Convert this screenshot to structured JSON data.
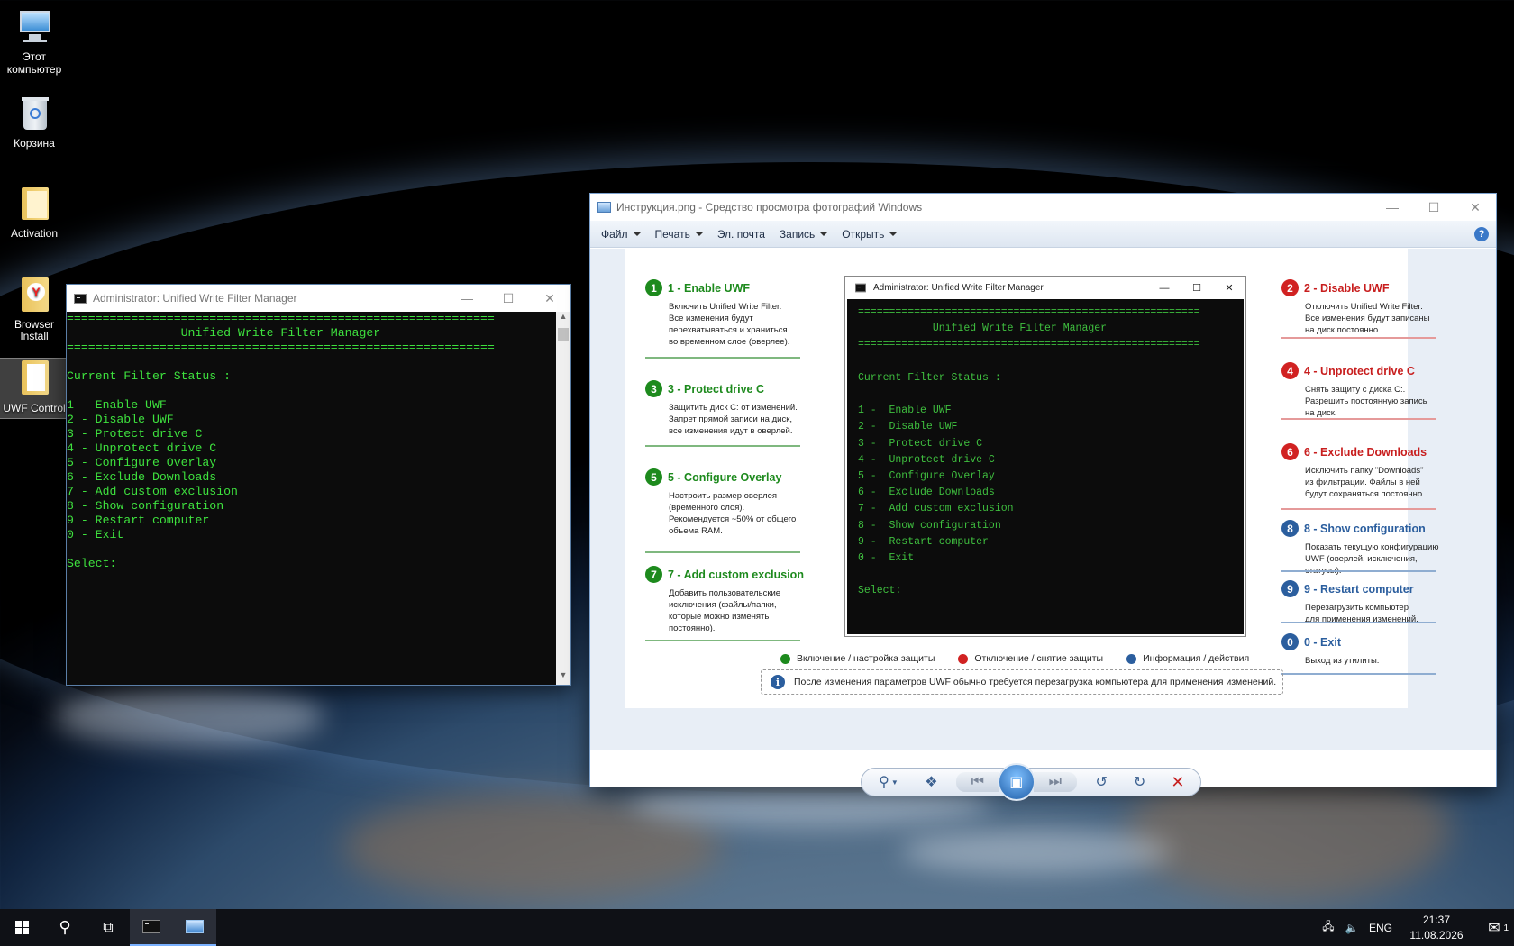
{
  "desktop": {
    "icons": [
      {
        "label": "Этот компьютер",
        "icon": "computer-icon"
      },
      {
        "label": "Корзина",
        "icon": "recycle-bin-icon"
      },
      {
        "label": "Activation",
        "icon": "folder-icon"
      },
      {
        "label": "Browser Install",
        "icon": "yandex-browser-icon"
      },
      {
        "label": "UWF Control",
        "icon": "folder-icon"
      }
    ]
  },
  "cmd_window": {
    "title": "Administrator:  Unified Write Filter Manager",
    "lines": [
      "============================================================",
      "                Unified Write Filter Manager",
      "============================================================",
      "",
      "Current Filter Status :",
      "",
      "1 - Enable UWF",
      "2 - Disable UWF",
      "3 - Protect drive C",
      "4 - Unprotect drive C",
      "5 - Configure Overlay",
      "6 - Exclude Downloads",
      "7 - Add custom exclusion",
      "8 - Show configuration",
      "9 - Restart computer",
      "0 - Exit",
      "",
      "Select:"
    ]
  },
  "viewer_window": {
    "title": "Инструкция.png - Средство просмотра фотографий Windows",
    "menu": [
      "Файл",
      "Печать",
      "Эл. почта",
      "Запись",
      "Открыть"
    ],
    "menu_has_arrow": [
      true,
      true,
      false,
      true,
      true
    ],
    "help": "?",
    "image": {
      "inner_cmd_title": "Administrator:  Unified Write Filter Manager",
      "inner_cmd_lines": [
        "=======================================================",
        "            Unified Write Filter Manager",
        "=======================================================",
        "",
        "Current Filter Status :",
        "",
        "1 -  Enable UWF",
        "2 -  Disable UWF",
        "3 -  Protect drive C",
        "4 -  Unprotect drive C",
        "5 -  Configure Overlay",
        "6 -  Exclude Downloads",
        "7 -  Add custom exclusion",
        "8 -  Show configuration",
        "9 -  Restart computer",
        "0 -  Exit",
        "",
        "Select:"
      ],
      "steps_left": [
        {
          "num": "1",
          "title": "1 - Enable UWF",
          "desc": "Включить Unified Write Filter.\nВсе изменения будут\nперехватываться и храниться\nво временном слое (оверлее).",
          "color": "g"
        },
        {
          "num": "3",
          "title": "3 - Protect drive C",
          "desc": "Защитить диск C: от изменений.\nЗапрет прямой записи на диск,\nвсе изменения идут в оверлей.",
          "color": "g"
        },
        {
          "num": "5",
          "title": "5 - Configure Overlay",
          "desc": "Настроить размер оверлея\n(временного слоя).\nРекомендуется ~50% от общего\nобъема RAM.",
          "color": "g"
        },
        {
          "num": "7",
          "title": "7 - Add custom exclusion",
          "desc": "Добавить пользовательские\nисключения (файлы/папки,\nкоторые можно изменять\nпостоянно).",
          "color": "g"
        }
      ],
      "steps_right": [
        {
          "num": "2",
          "title": "2 - Disable UWF",
          "desc": "Отключить Unified Write Filter.\nВсе изменения будут записаны\nна диск постоянно.",
          "color": "r"
        },
        {
          "num": "4",
          "title": "4 - Unprotect drive C",
          "desc": "Снять защиту с диска C:.\nРазрешить постоянную запись\nна диск.",
          "color": "r"
        },
        {
          "num": "6",
          "title": "6 - Exclude Downloads",
          "desc": "Исключить папку \"Downloads\"\nиз фильтрации. Файлы в ней\nбудут сохраняться постоянно.",
          "color": "r"
        },
        {
          "num": "8",
          "title": "8 - Show configuration",
          "desc": "Показать текущую конфигурацию\nUWF (оверлей, исключения,\nстатусы).",
          "color": "b"
        },
        {
          "num": "9",
          "title": "9 - Restart computer",
          "desc": "Перезагрузить компьютер\nдля применения изменений.",
          "color": "b"
        },
        {
          "num": "0",
          "title": "0 - Exit",
          "desc": "Выход из утилиты.",
          "color": "b"
        }
      ],
      "legend": [
        {
          "label": "Включение / настройка защиты",
          "color": "#1d8a1d"
        },
        {
          "label": "Отключение / снятие защиты",
          "color": "#d12222"
        },
        {
          "label": "Информация / действия",
          "color": "#2b5e9e"
        }
      ],
      "note": "После изменения параметров UWF обычно требуется перезагрузка компьютера для применения изменений."
    }
  },
  "taskbar": {
    "lang": "ENG",
    "time": "21:37",
    "date": "11.08.2026",
    "notification_count": "1"
  }
}
